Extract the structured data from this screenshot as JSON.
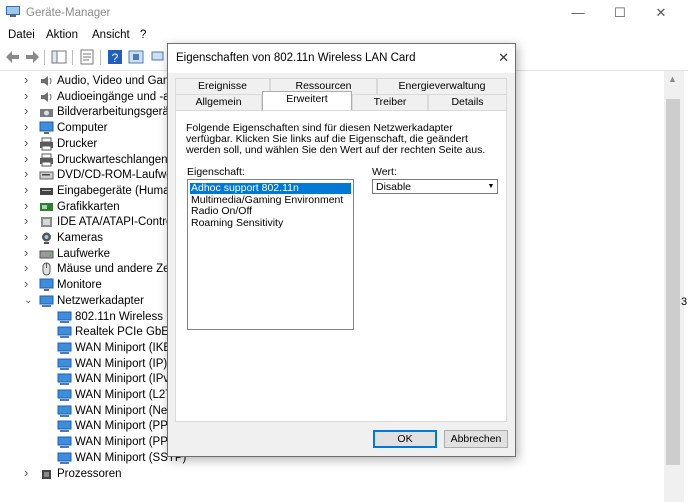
{
  "device_manager": {
    "title": "Geräte-Manager",
    "window_controls": {
      "minimize": "—",
      "maximize": "☐",
      "close": "✕"
    },
    "menu": [
      {
        "key": "D",
        "rest": "atei"
      },
      {
        "key": "",
        "pre": "Ak",
        "mid": "t",
        "post": "ion"
      },
      {
        "key": "A",
        "rest": "nsicht"
      },
      {
        "key": "?",
        "rest": ""
      }
    ],
    "menu_labels": [
      "Datei",
      "Aktion",
      "Ansicht",
      "?"
    ],
    "tree": [
      {
        "label": "Audio, Video und Game",
        "expanded": false,
        "icon": "speaker-icon"
      },
      {
        "label": "Audioeingänge und -au",
        "expanded": false,
        "icon": "speaker-icon"
      },
      {
        "label": "Bildverarbeitungsgeräte",
        "expanded": false,
        "icon": "camera-icon"
      },
      {
        "label": "Computer",
        "expanded": false,
        "icon": "monitor-icon"
      },
      {
        "label": "Drucker",
        "expanded": false,
        "icon": "printer-icon"
      },
      {
        "label": "Druckwarteschlangen",
        "expanded": false,
        "icon": "printer-icon"
      },
      {
        "label": "DVD/CD-ROM-Laufwerk",
        "expanded": false,
        "icon": "disc-drive-icon"
      },
      {
        "label": "Eingabegeräte (Human",
        "expanded": false,
        "icon": "keyboard-icon"
      },
      {
        "label": "Grafikkarten",
        "expanded": false,
        "icon": "display-adapter-icon"
      },
      {
        "label": "IDE ATA/ATAPI-Controlle",
        "expanded": false,
        "icon": "controller-icon"
      },
      {
        "label": "Kameras",
        "expanded": false,
        "icon": "webcam-icon"
      },
      {
        "label": "Laufwerke",
        "expanded": false,
        "icon": "disk-icon"
      },
      {
        "label": "Mäuse und andere Zeig",
        "expanded": false,
        "icon": "mouse-icon"
      },
      {
        "label": "Monitore",
        "expanded": false,
        "icon": "monitor-icon"
      },
      {
        "label": "Netzwerkadapter",
        "expanded": true,
        "icon": "network-adapter-icon"
      },
      {
        "label": "802.11n Wireless LAN",
        "child": true,
        "icon": "network-adapter-icon"
      },
      {
        "label": "Realtek PCIe GbE Far",
        "child": true,
        "icon": "network-adapter-icon"
      },
      {
        "label": "WAN Miniport (IKEv",
        "child": true,
        "icon": "network-adapter-icon"
      },
      {
        "label": "WAN Miniport (IP)",
        "child": true,
        "icon": "network-adapter-icon"
      },
      {
        "label": "WAN Miniport (IPv6",
        "child": true,
        "icon": "network-adapter-icon"
      },
      {
        "label": "WAN Miniport (L2TP",
        "child": true,
        "icon": "network-adapter-icon"
      },
      {
        "label": "WAN Miniport (Netw",
        "child": true,
        "icon": "network-adapter-icon"
      },
      {
        "label": "WAN Miniport (PPPC",
        "child": true,
        "icon": "network-adapter-icon"
      },
      {
        "label": "WAN Miniport (PPTF",
        "child": true,
        "icon": "network-adapter-icon"
      },
      {
        "label": "WAN Miniport (SSTP)",
        "child": true,
        "icon": "network-adapter-icon"
      },
      {
        "label": "Prozessoren",
        "expanded": false,
        "icon": "processor-icon"
      }
    ],
    "right_fragment": "3"
  },
  "dialog": {
    "title": "Eigenschaften von 802.11n Wireless LAN Card",
    "close": "✕",
    "tabs_row1": [
      "Ereignisse",
      "Ressourcen",
      "Energieverwaltung"
    ],
    "tabs_row2": [
      "Allgemein",
      "Erweitert",
      "Treiber",
      "Details"
    ],
    "active_tab": "Erweitert",
    "description": "Folgende Eigenschaften sind für diesen Netzwerkadapter verfügbar. Klicken Sie links auf die Eigenschaft, die geändert werden soll, und wählen Sie den Wert auf der rechten Seite aus.",
    "property_label": "Eigenschaft:",
    "value_label": "Wert:",
    "properties": [
      "Adhoc support 802.11n",
      "Multimedia/Gaming Environment",
      "Radio On/Off",
      "Roaming Sensitivity"
    ],
    "selected_property": "Adhoc support 802.11n",
    "value": "Disable",
    "ok_label": "OK",
    "cancel_label": "Abbrechen"
  },
  "colors": {
    "selection": "#0078d7",
    "dialog_bg": "#f0f0f0"
  }
}
